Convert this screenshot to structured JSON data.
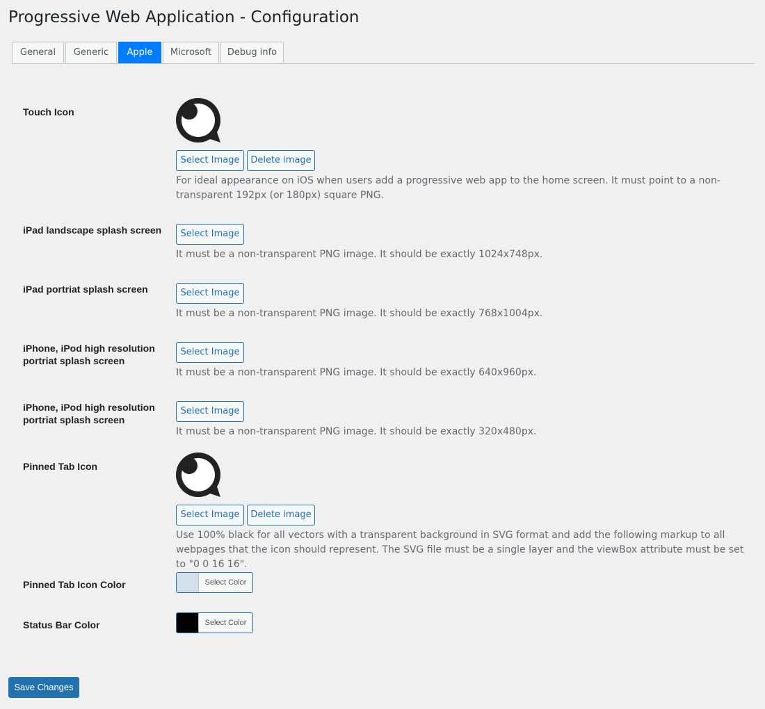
{
  "page_title": "Progressive Web Application - Configuration",
  "tabs": [
    {
      "label": "General",
      "active": false
    },
    {
      "label": "Generic",
      "active": false
    },
    {
      "label": "Apple",
      "active": true
    },
    {
      "label": "Microsoft",
      "active": false
    },
    {
      "label": "Debug info",
      "active": false
    }
  ],
  "buttons": {
    "select_image": "Select Image",
    "delete_image": "Delete image",
    "select_color": "Select Color",
    "save_changes": "Save Changes"
  },
  "rows": {
    "touch_icon": {
      "label": "Touch Icon",
      "description": "For ideal appearance on iOS when users add a progressive web app to the home screen. It must point to a non-transparent 192px (or 180px) square PNG."
    },
    "ipad_landscape": {
      "label": "iPad landscape splash screen",
      "description": "It must be a non-transparent PNG image. It should be exactly 1024x748px."
    },
    "ipad_portrait": {
      "label": "iPad portriat splash screen",
      "description": "It must be a non-transparent PNG image. It should be exactly 768x1004px."
    },
    "iphone_hires": {
      "label": "iPhone, iPod high resolution portriat splash screen",
      "description": "It must be a non-transparent PNG image. It should be exactly 640x960px."
    },
    "iphone_std": {
      "label": "iPhone, iPod high resolution portriat splash screen",
      "description": "It must be a non-transparent PNG image. It should be exactly 320x480px."
    },
    "pinned_tab_icon": {
      "label": "Pinned Tab Icon",
      "description": "Use 100% black for all vectors with a transparent background in SVG format and add the following markup to all webpages that the icon should represent. The SVG file must be a single layer and the viewBox attribute must be set to \"0 0 16 16\"."
    },
    "pinned_tab_color": {
      "label": "Pinned Tab Icon Color",
      "swatch": "#d2e0ec"
    },
    "status_bar_color": {
      "label": "Status Bar Color",
      "swatch": "#000000"
    }
  },
  "icons": {
    "touch_icon_preview": "pwa-logo-icon",
    "pinned_icon_preview": "pwa-logo-icon"
  }
}
